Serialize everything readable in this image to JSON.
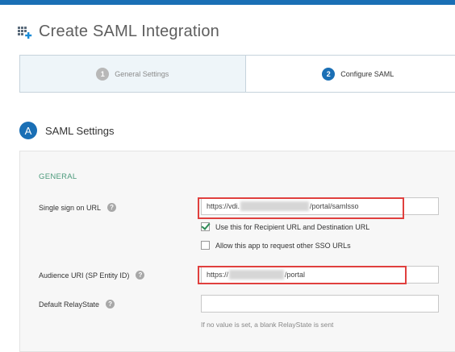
{
  "page": {
    "title": "Create SAML Integration"
  },
  "stepper": {
    "steps": [
      {
        "number": "1",
        "label": "General Settings"
      },
      {
        "number": "2",
        "label": "Configure SAML"
      }
    ]
  },
  "section": {
    "badge": "A",
    "title": "SAML Settings"
  },
  "general": {
    "group_label": "GENERAL",
    "sso_url": {
      "label": "Single sign on URL",
      "help": "?",
      "value_prefix": "https://vdi.",
      "value_suffix": "/portal/samlsso"
    },
    "recipient_checkbox": {
      "label": "Use this for Recipient URL and Destination URL",
      "checked": true
    },
    "other_sso_checkbox": {
      "label": "Allow this app to request other SSO URLs",
      "checked": false
    },
    "audience_uri": {
      "label": "Audience URI (SP Entity ID)",
      "help": "?",
      "value_prefix": "https://",
      "value_suffix": "/portal"
    },
    "relay_state": {
      "label": "Default RelayState",
      "help": "?",
      "value": "",
      "hint": "If no value is set, a blank RelayState is sent"
    }
  },
  "colors": {
    "brand": "#1a6fb5",
    "highlight": "#e0403e",
    "group_label": "#4b9a7b"
  }
}
